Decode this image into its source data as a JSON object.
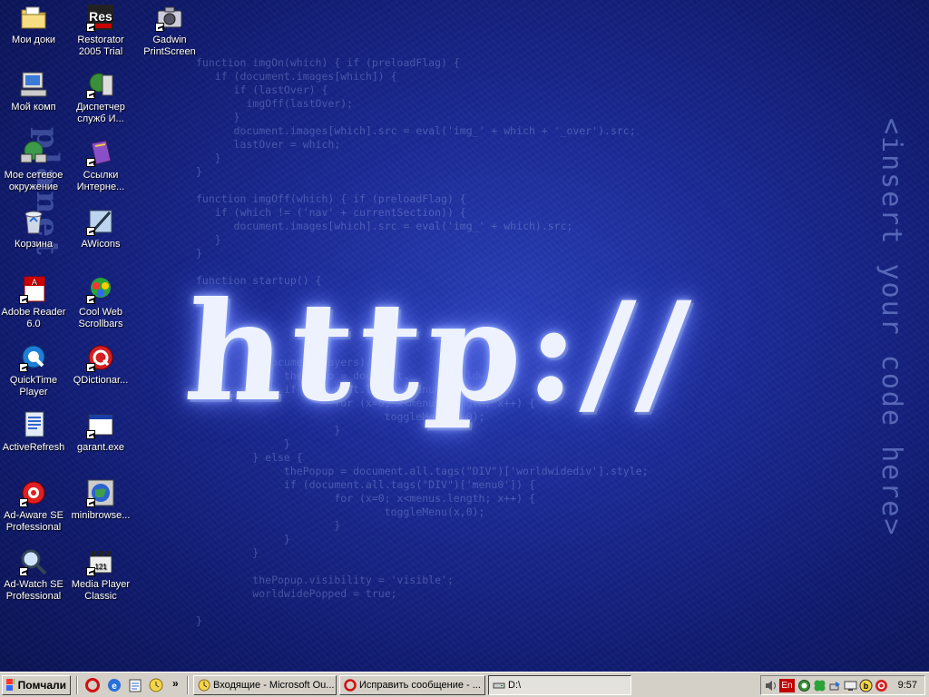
{
  "wallpaper": {
    "code_lines": [
      "function imgOn(which) { if (preloadFlag) {",
      "   if (document.images[which]) {",
      "      if (lastOver) {",
      "        imgOff(lastOver);",
      "      }",
      "      document.images[which].src = eval('img_' + which + '_over').src;",
      "      lastOver = which;",
      "   }",
      "}",
      "",
      "function imgOff(which) { if (preloadFlag) {",
      "   if (which != ('nav' + currentSection)) {",
      "      document.images[which].src = eval('img_' + which).src;",
      "   }",
      "}",
      "",
      "function startup() {",
      "",
      "",
      "",
      "",
      "",
      "           document.layers) {",
      "              thePopup = document.      worldwidedi",
      "              if (document.layers[menu0]) {",
      "                      for (x=0; x<menus.length; x++) {",
      "                              toggleMenu(x,0);",
      "                      }",
      "              }",
      "         } else {",
      "              thePopup = document.all.tags(\"DIV\")['worldwidediv'].style;",
      "              if (document.all.tags(\"DIV\")['menu0']) {",
      "                      for (x=0; x<menus.length; x++) {",
      "                              toggleMenu(x,0);",
      "                      }",
      "              }",
      "         }",
      "",
      "         thePopup.visibility = 'visible';",
      "         worldwidePopped = true;",
      "",
      "}"
    ],
    "big_text": "http://",
    "right_text": "<insert your code here>",
    "left_text": "planet"
  },
  "desktop": {
    "icons": [
      {
        "label": "Мои доки",
        "icon": "folder-documents-icon",
        "shortcut": false
      },
      {
        "label": "Мой комп",
        "icon": "computer-icon",
        "shortcut": false
      },
      {
        "label": "Мое сетевое окружение",
        "icon": "network-icon",
        "shortcut": false
      },
      {
        "label": "Корзина",
        "icon": "recycle-bin-icon",
        "shortcut": false
      },
      {
        "label": "Adobe Reader 6.0",
        "icon": "adobe-reader-icon",
        "shortcut": true
      },
      {
        "label": "QuickTime Player",
        "icon": "quicktime-icon",
        "shortcut": true
      },
      {
        "label": "ActiveRefresh",
        "icon": "activerefresh-icon",
        "shortcut": false
      },
      {
        "label": "Ad-Aware SE Professional",
        "icon": "ad-aware-icon",
        "shortcut": true
      },
      {
        "label": "Ad-Watch SE Professional",
        "icon": "ad-watch-icon",
        "shortcut": true
      },
      {
        "label": "Restorator 2005 Trial",
        "icon": "restorator-icon",
        "shortcut": true
      },
      {
        "label": "Диспетчер служб И...",
        "icon": "service-manager-icon",
        "shortcut": true
      },
      {
        "label": "Ссылки Интерне...",
        "icon": "internet-links-icon",
        "shortcut": true
      },
      {
        "label": "AWicons",
        "icon": "awicons-icon",
        "shortcut": true
      },
      {
        "label": "Cool Web Scrollbars",
        "icon": "cool-web-scrollbars-icon",
        "shortcut": true
      },
      {
        "label": "QDictionar...",
        "icon": "qdictionary-icon",
        "shortcut": true
      },
      {
        "label": "garant.exe",
        "icon": "exe-window-icon",
        "shortcut": true
      },
      {
        "label": "minibrowse...",
        "icon": "minibrowser-icon",
        "shortcut": true
      },
      {
        "label": "Media Player Classic",
        "icon": "media-player-icon",
        "shortcut": true
      },
      {
        "label": "Gadwin PrintScreen",
        "icon": "camera-icon",
        "shortcut": true
      }
    ]
  },
  "taskbar": {
    "start_label": "Помчали",
    "quicklaunch": [
      "opera-icon",
      "ie-icon",
      "notepad-icon",
      "clock-icon"
    ],
    "overflow": "»",
    "tasks": [
      {
        "label": "Входящие - Microsoft Ou...",
        "icon": "outlook-icon",
        "active": false
      },
      {
        "label": "Исправить сообщение - ...",
        "icon": "opera-icon",
        "active": false
      },
      {
        "label": "D:\\",
        "icon": "drive-icon",
        "active": true
      }
    ],
    "tray": {
      "language": "En",
      "clock": "9:57"
    }
  }
}
